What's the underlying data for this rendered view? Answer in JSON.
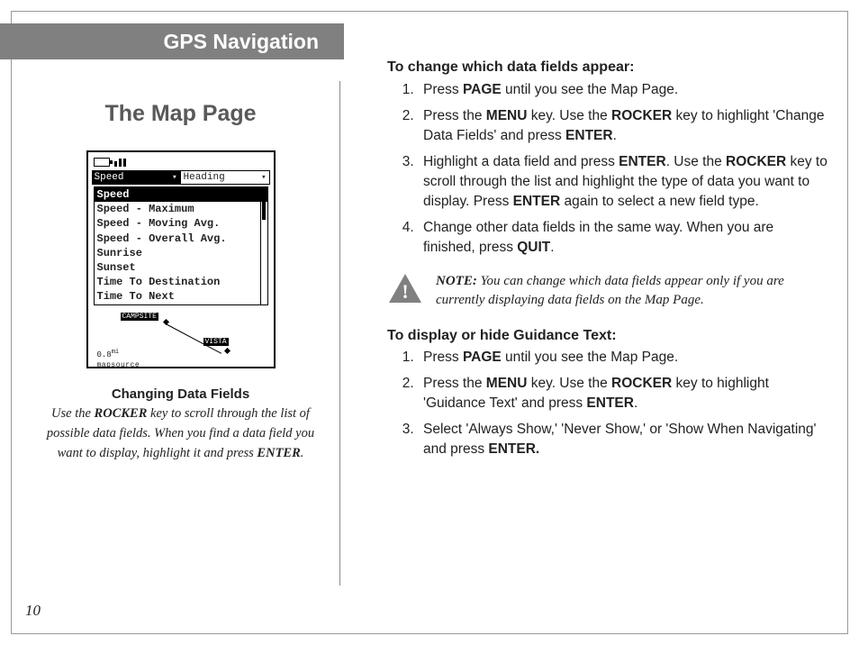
{
  "header": {
    "title": "GPS Navigation"
  },
  "page_number": "10",
  "left": {
    "section_title": "The Map Page",
    "device": {
      "tab_selected": "Speed",
      "tab_other": "Heading",
      "list": [
        "Speed",
        "Speed - Maximum",
        "Speed - Moving Avg.",
        "Speed - Overall Avg.",
        "Sunrise",
        "Sunset",
        "Time To Destination",
        "Time To Next"
      ],
      "waypoint_a": "CAMPSITE",
      "waypoint_b": "VISTA",
      "scale": "0.8",
      "scale_unit": "mi",
      "mapsource": "mapsource"
    },
    "caption_title": "Changing Data Fields",
    "caption_body_1": "Use the ",
    "caption_key_1": "ROCKER",
    "caption_body_2": " key to scroll through the list of possible data fields. When you find a data field you want to display, highlight it and press ",
    "caption_key_2": "ENTER",
    "caption_body_3": "."
  },
  "right": {
    "proc1_heading": "To change which data fields appear:",
    "proc1": {
      "s1a": "Press ",
      "s1k1": "PAGE",
      "s1b": " until you see the Map Page.",
      "s2a": "Press the ",
      "s2k1": "MENU",
      "s2b": " key. Use the ",
      "s2k2": "ROCKER",
      "s2c": " key to highlight 'Change Data Fields' and press ",
      "s2k3": "ENTER",
      "s2d": ".",
      "s3a": "Highlight a data field and press ",
      "s3k1": "ENTER",
      "s3b": ". Use the ",
      "s3k2": "ROCKER",
      "s3c": " key to scroll through the list and highlight the type of data you want to display. Press ",
      "s3k3": "ENTER",
      "s3d": " again to select a new field type.",
      "s4a": "Change other data fields in the same way. When you are finished, press ",
      "s4k1": "QUIT",
      "s4b": "."
    },
    "note_label": "NOTE:",
    "note_text": " You can change which data fields appear only if you are currently displaying data fields on the Map Page.",
    "proc2_heading": "To display or hide Guidance Text:",
    "proc2": {
      "s1a": "Press ",
      "s1k1": "PAGE",
      "s1b": " until you see the Map Page.",
      "s2a": "Press the ",
      "s2k1": "MENU",
      "s2b": " key. Use the ",
      "s2k2": "ROCKER",
      "s2c": " key to highlight 'Guidance Text' and press ",
      "s2k3": "ENTER",
      "s2d": ".",
      "s3a": "Select 'Always Show,' 'Never Show,' or 'Show When Navigating' and press ",
      "s3k1": "ENTER.",
      "s3b": ""
    }
  }
}
